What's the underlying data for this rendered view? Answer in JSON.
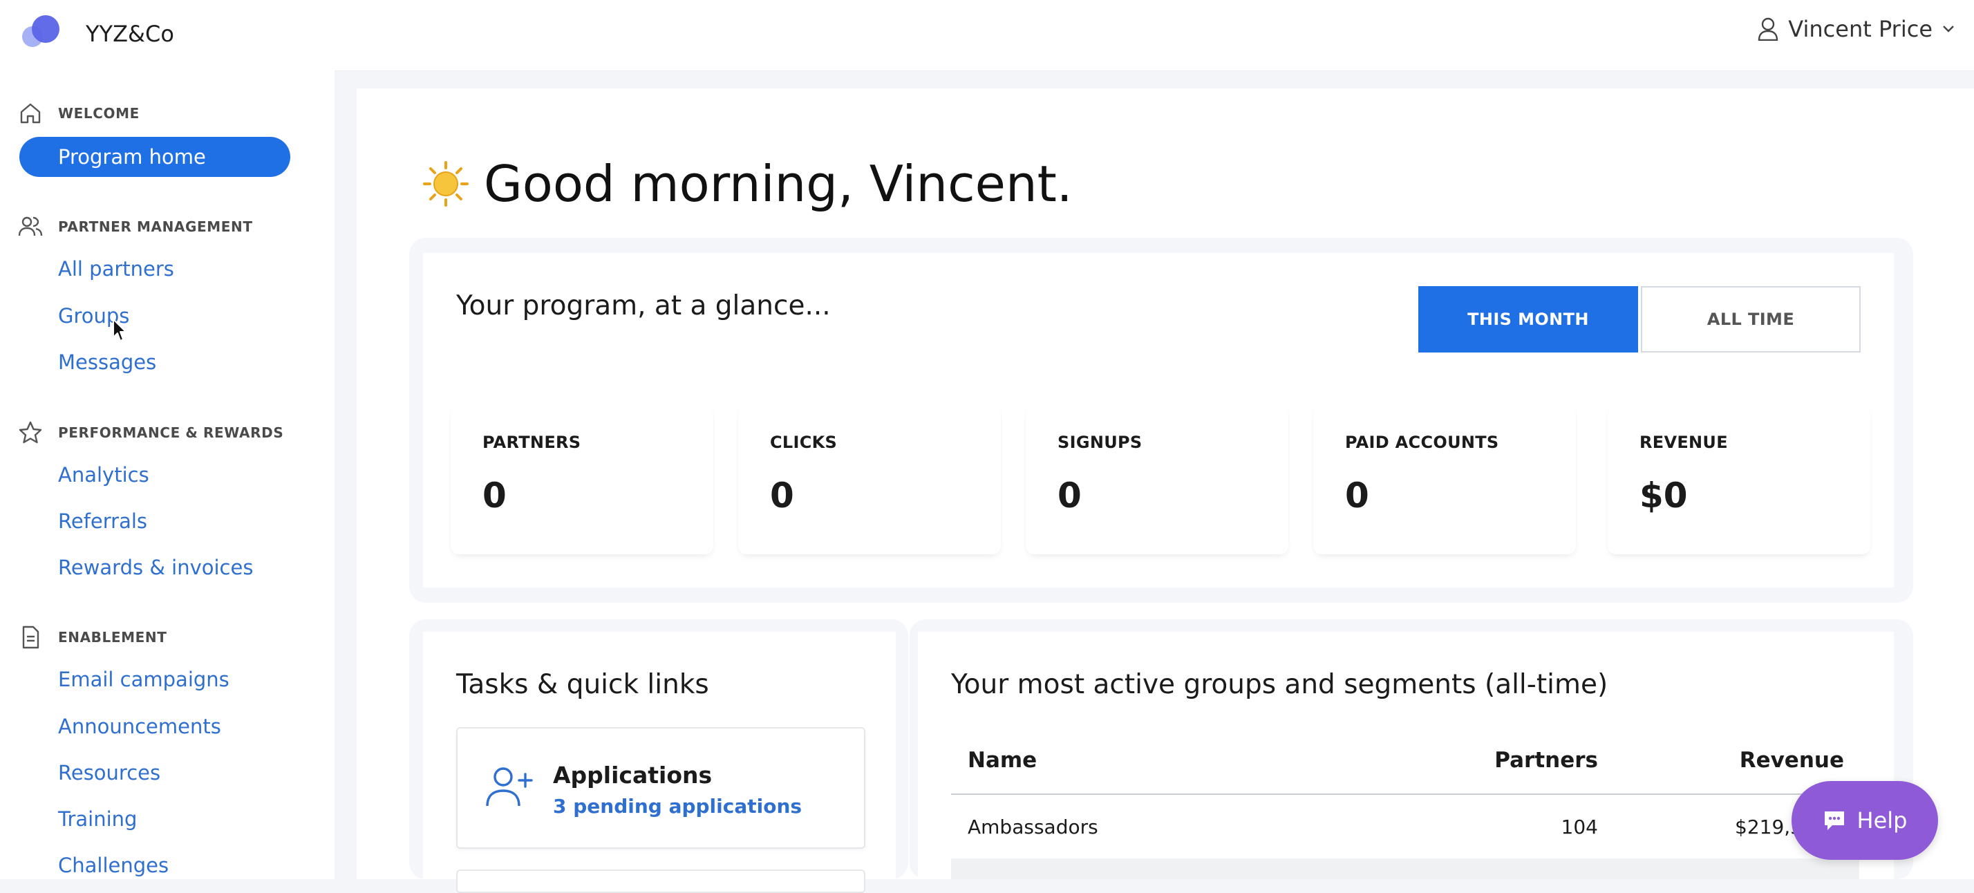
{
  "header": {
    "brand": "YYZ&Co",
    "user_name": "Vincent Price"
  },
  "sidebar": {
    "sections": [
      {
        "title": "WELCOME",
        "items": [
          "Program home"
        ]
      },
      {
        "title": "PARTNER MANAGEMENT",
        "items": [
          "All partners",
          "Groups",
          "Messages"
        ]
      },
      {
        "title": "PERFORMANCE & REWARDS",
        "items": [
          "Analytics",
          "Referrals",
          "Rewards & invoices"
        ]
      },
      {
        "title": "ENABLEMENT",
        "items": [
          "Email campaigns",
          "Announcements",
          "Resources",
          "Training",
          "Challenges"
        ]
      }
    ]
  },
  "main": {
    "greeting": "Good morning, Vincent.",
    "glance": {
      "title": "Your program, at a glance...",
      "toggle": {
        "active": "THIS MONTH",
        "inactive": "ALL TIME"
      },
      "metrics": [
        {
          "label": "PARTNERS",
          "value": "0"
        },
        {
          "label": "CLICKS",
          "value": "0"
        },
        {
          "label": "SIGNUPS",
          "value": "0"
        },
        {
          "label": "PAID ACCOUNTS",
          "value": "0"
        },
        {
          "label": "REVENUE",
          "value": "$0"
        }
      ]
    },
    "tasks": {
      "title": "Tasks & quick links",
      "applications_title": "Applications",
      "applications_link": "3 pending applications"
    },
    "groups": {
      "title": "Your most active groups and segments (all-time)",
      "columns": [
        "Name",
        "Partners",
        "Revenue"
      ],
      "rows": [
        {
          "name": "Ambassadors",
          "partners": "104",
          "revenue": "$219,3"
        }
      ]
    }
  },
  "help_label": "Help",
  "colors": {
    "accent": "#1f6fe5",
    "link": "#2e6fd0",
    "help": "#8e5ad8"
  }
}
